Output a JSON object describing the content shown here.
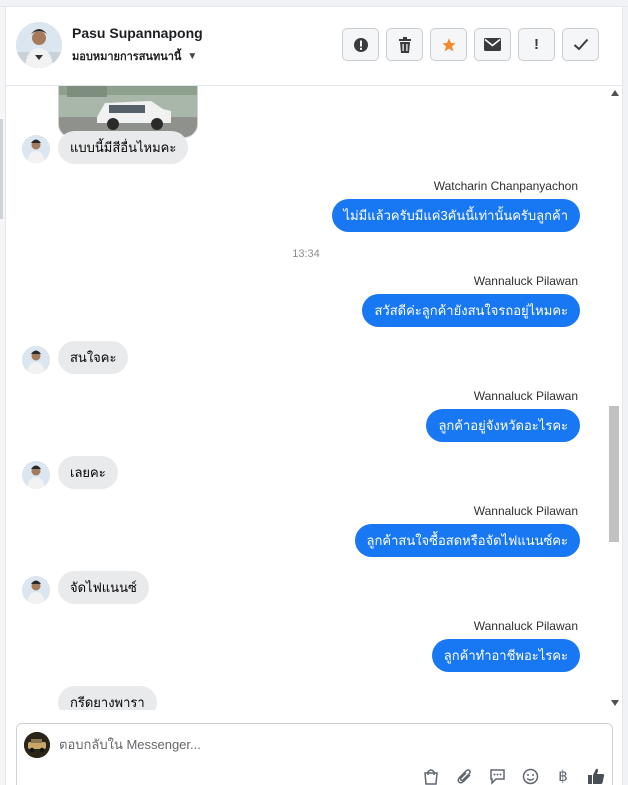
{
  "header": {
    "contact_name": "Pasu Supannapong",
    "assignee_label": "มอบหมายการสนทนานี้",
    "actions": [
      {
        "name": "alert-circle-icon",
        "label": ""
      },
      {
        "name": "trash-icon",
        "label": ""
      },
      {
        "name": "star-icon",
        "label": ""
      },
      {
        "name": "envelope-icon",
        "label": ""
      },
      {
        "name": "exclamation-icon",
        "label": "!"
      },
      {
        "name": "checkmark-icon",
        "label": ""
      }
    ]
  },
  "messages": [
    {
      "direction": "in",
      "text": "แบบนี้มีสีอื่นไหมคะ"
    },
    {
      "direction": "out",
      "sender": "Watcharin Chanpanyachon",
      "text": "ไม่มีแล้วครับมีแค่3คันนี้เท่านั้นครับลูกค้า"
    },
    {
      "type": "timestamp",
      "text": "13:34"
    },
    {
      "direction": "out",
      "sender": "Wannaluck Pilawan",
      "text": "สวัสดีค่ะลูกค้ายังสนใจรถอยู่ไหมคะ"
    },
    {
      "direction": "in",
      "text": "สนใจคะ"
    },
    {
      "direction": "out",
      "sender": "Wannaluck Pilawan",
      "text": "ลูกค้าอยู่จังหวัดอะไรคะ"
    },
    {
      "direction": "in",
      "text": "เลยคะ"
    },
    {
      "direction": "out",
      "sender": "Wannaluck Pilawan",
      "text": "ลูกค้าสนใจซื้อสดหรือจัดไฟแนนซ์คะ"
    },
    {
      "direction": "in",
      "text": "จัดไฟแนนซ์"
    },
    {
      "direction": "out",
      "sender": "Wannaluck Pilawan",
      "text": "ลูกค้าทำอาชีพอะไรคะ"
    },
    {
      "direction": "in",
      "text": "กรีดยางพารา"
    }
  ],
  "composer": {
    "placeholder": "ตอบกลับใน Messenger...",
    "tools": [
      "shopping-bag-icon",
      "paperclip-icon",
      "chat-bubble-icon",
      "smiley-icon",
      "baht-icon",
      "thumbs-up-icon"
    ]
  },
  "colors": {
    "outgoing_bubble": "#1877f2",
    "incoming_bubble": "#e9eaec",
    "star_accent": "#f5892b"
  }
}
